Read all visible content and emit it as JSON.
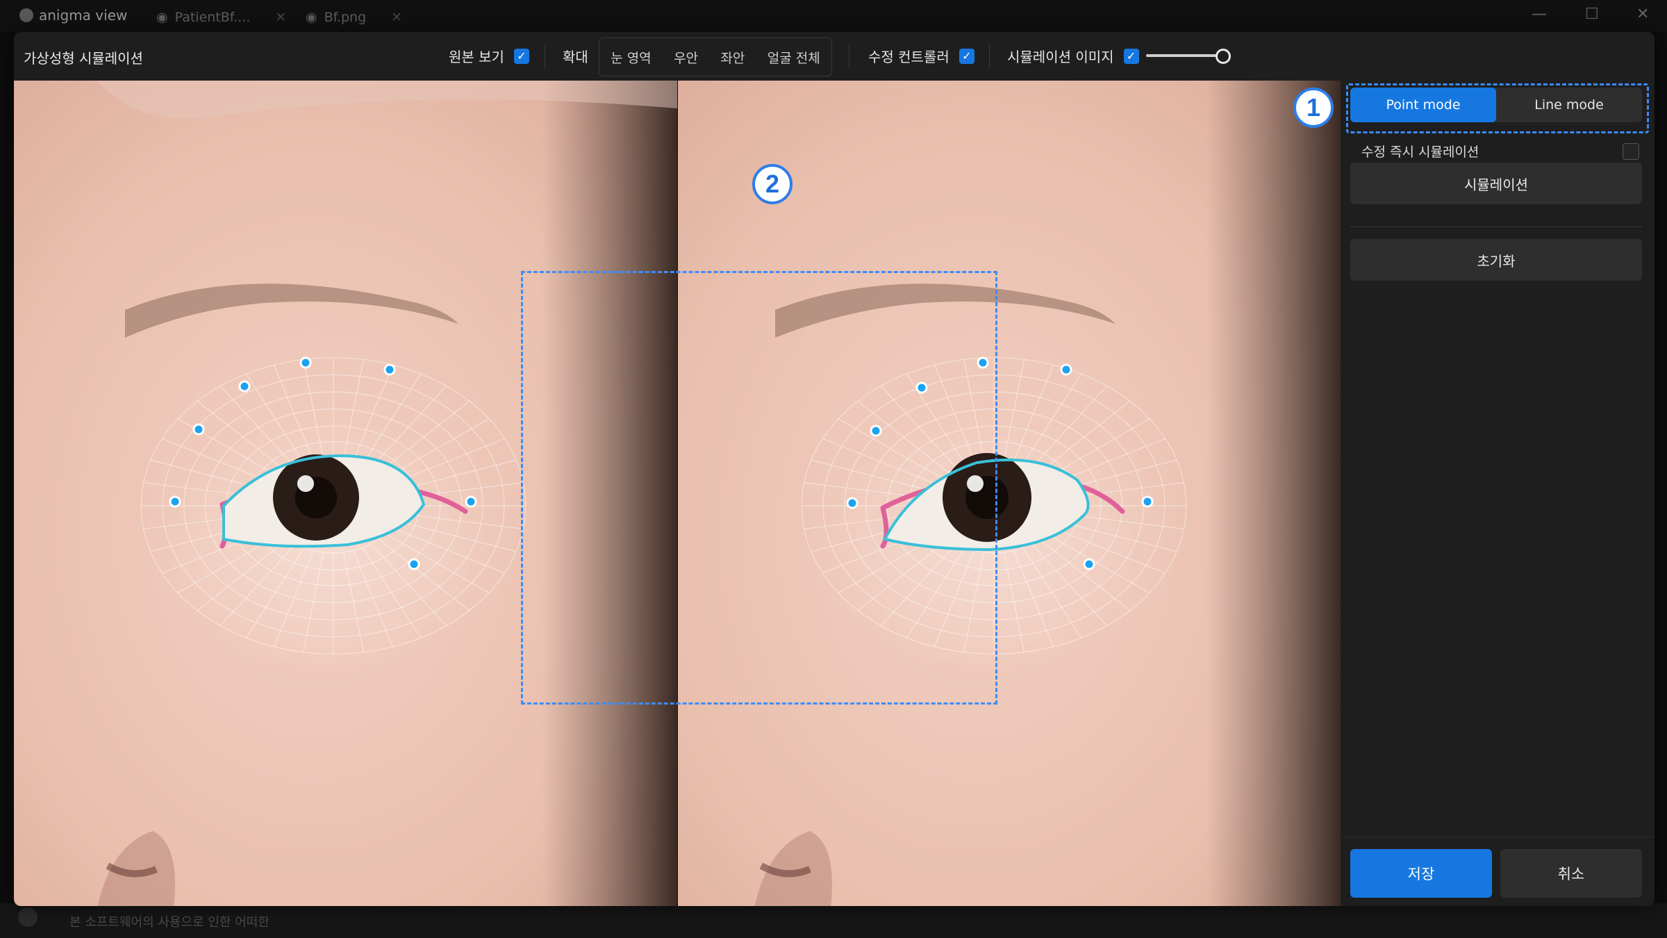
{
  "app": {
    "logo_text": "anigma view"
  },
  "bg_tabs": [
    {
      "label": "PatientBf...."
    },
    {
      "label": "Bf.png"
    }
  ],
  "bg_footer_text": "본 소프트웨어의 사용으로 인한 어떠한",
  "dialog": {
    "title": "가상성형 시뮬레이션"
  },
  "toolbar": {
    "show_original": {
      "label": "원본 보기",
      "checked": true
    },
    "zoom": {
      "label": "확대",
      "options": [
        "눈 영역",
        "우안",
        "좌안",
        "얼굴 전체"
      ]
    },
    "edit_controller": {
      "label": "수정 컨트롤러",
      "checked": true
    },
    "sim_image": {
      "label": "시뮬레이션 이미지",
      "checked": true,
      "opacity": 1.0
    }
  },
  "side": {
    "modes": [
      {
        "label": "Point mode",
        "active": true
      },
      {
        "label": "Line mode",
        "active": false
      }
    ],
    "instant_sim": {
      "label": "수정 즉시 시뮬레이션",
      "checked": false
    },
    "simulate_label": "시뮬레이션",
    "reset_label": "초기화",
    "save_label": "저장",
    "cancel_label": "취소"
  },
  "markers": {
    "one": "1",
    "two": "2"
  },
  "colors": {
    "accent": "#1677e0",
    "annotation": "#3b8cff",
    "eyelid_curve": "#39c0d8",
    "fold_line": "#e0609a",
    "control_point": "#1aa3f0"
  }
}
